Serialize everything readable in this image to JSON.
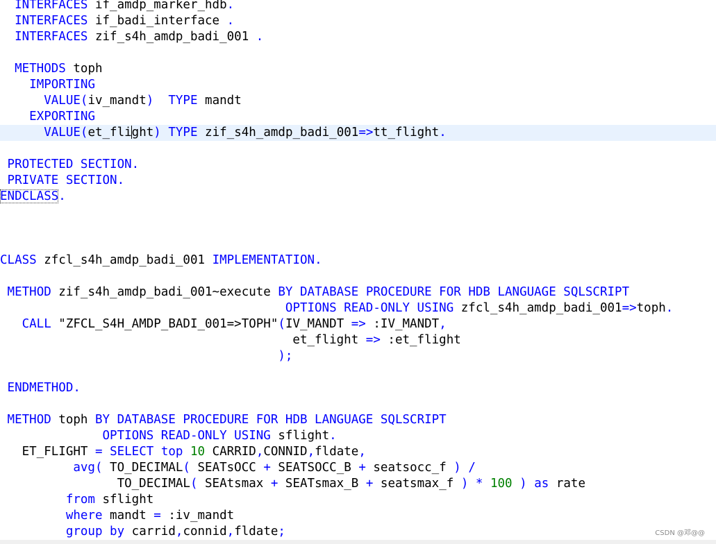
{
  "editor": {
    "lines": [
      [
        {
          "t": "  "
        },
        {
          "t": "INTERFACES",
          "k": "kw"
        },
        {
          "t": " if_amdp_marker_hdb"
        },
        {
          "t": ".",
          "k": "kw"
        }
      ],
      [
        {
          "t": "  "
        },
        {
          "t": "INTERFACES",
          "k": "kw"
        },
        {
          "t": " if_badi_interface "
        },
        {
          "t": ".",
          "k": "kw"
        }
      ],
      [
        {
          "t": "  "
        },
        {
          "t": "INTERFACES",
          "k": "kw"
        },
        {
          "t": " zif_s4h_amdp_badi_001 "
        },
        {
          "t": ".",
          "k": "kw"
        }
      ],
      [],
      [
        {
          "t": "  "
        },
        {
          "t": "METHODS",
          "k": "kw"
        },
        {
          "t": " toph"
        }
      ],
      [
        {
          "t": "    "
        },
        {
          "t": "IMPORTING",
          "k": "kw"
        }
      ],
      [
        {
          "t": "      "
        },
        {
          "t": "VALUE(",
          "k": "kw"
        },
        {
          "t": "iv_mandt"
        },
        {
          "t": ")",
          "k": "kw"
        },
        {
          "t": "  "
        },
        {
          "t": "TYPE",
          "k": "kw"
        },
        {
          "t": " mandt"
        }
      ],
      [
        {
          "t": "    "
        },
        {
          "t": "EXPORTING",
          "k": "kw"
        }
      ],
      [
        {
          "t": "      "
        },
        {
          "t": "VALUE(",
          "k": "kw"
        },
        {
          "t": "et_fli"
        },
        {
          "caret": true
        },
        {
          "t": "ght"
        },
        {
          "t": ")",
          "k": "kw"
        },
        {
          "t": " "
        },
        {
          "t": "TYPE",
          "k": "kw"
        },
        {
          "t": " zif_s4h_amdp_badi_001"
        },
        {
          "t": "=>",
          "k": "kw"
        },
        {
          "t": "tt_flight"
        },
        {
          "t": ".",
          "k": "kw"
        }
      ],
      [],
      [
        {
          "t": " "
        },
        {
          "t": "PROTECTED SECTION.",
          "k": "kw"
        }
      ],
      [
        {
          "t": " "
        },
        {
          "t": "PRIVATE SECTION.",
          "k": "kw"
        }
      ],
      [
        {
          "t": "ENDCLASS",
          "k": "kw",
          "box": true
        },
        {
          "t": ".",
          "k": "kw"
        }
      ],
      [],
      [],
      [],
      [
        {
          "t": "CLASS",
          "k": "kw"
        },
        {
          "t": " zfcl_s4h_amdp_badi_001 "
        },
        {
          "t": "IMPLEMENTATION.",
          "k": "kw"
        }
      ],
      [],
      [
        {
          "t": " "
        },
        {
          "t": "METHOD",
          "k": "kw"
        },
        {
          "t": " zif_s4h_amdp_badi_001~execute "
        },
        {
          "t": "BY DATABASE PROCEDURE FOR HDB LANGUAGE SQLSCRIPT",
          "k": "kw"
        }
      ],
      [
        {
          "t": "                                       "
        },
        {
          "t": "OPTIONS READ-ONLY USING",
          "k": "kw"
        },
        {
          "t": " zfcl_s4h_amdp_badi_001"
        },
        {
          "t": "=>",
          "k": "kw"
        },
        {
          "t": "toph"
        },
        {
          "t": ".",
          "k": "kw"
        }
      ],
      [
        {
          "t": "   "
        },
        {
          "t": "CALL",
          "k": "kw"
        },
        {
          "t": " \"ZFCL_S4H_AMDP_BADI_001=>TOPH\""
        },
        {
          "t": "(",
          "k": "kw"
        },
        {
          "t": "IV_MANDT "
        },
        {
          "t": "=>",
          "k": "kw"
        },
        {
          "t": " :IV_MANDT"
        },
        {
          "t": ",",
          "k": "kw"
        }
      ],
      [
        {
          "t": "                                        et_flight "
        },
        {
          "t": "=>",
          "k": "kw"
        },
        {
          "t": " :et_flight"
        }
      ],
      [
        {
          "t": "                                      "
        },
        {
          "t": ");",
          "k": "kw"
        }
      ],
      [],
      [
        {
          "t": " "
        },
        {
          "t": "ENDMETHOD.",
          "k": "kw"
        }
      ],
      [],
      [
        {
          "t": " "
        },
        {
          "t": "METHOD",
          "k": "kw"
        },
        {
          "t": " toph "
        },
        {
          "t": "BY DATABASE PROCEDURE FOR HDB LANGUAGE SQLSCRIPT",
          "k": "kw"
        }
      ],
      [
        {
          "t": "              "
        },
        {
          "t": "OPTIONS READ-ONLY USING",
          "k": "kw"
        },
        {
          "t": " sflight"
        },
        {
          "t": ".",
          "k": "kw"
        }
      ],
      [
        {
          "t": "   ET_FLIGHT "
        },
        {
          "t": "=",
          "k": "kw"
        },
        {
          "t": " "
        },
        {
          "t": "SELECT top",
          "k": "kw"
        },
        {
          "t": " "
        },
        {
          "t": "10",
          "k": "num"
        },
        {
          "t": " CARRID"
        },
        {
          "t": ",",
          "k": "kw"
        },
        {
          "t": "CONNID"
        },
        {
          "t": ",",
          "k": "kw"
        },
        {
          "t": "fldate"
        },
        {
          "t": ",",
          "k": "kw"
        }
      ],
      [
        {
          "t": "          "
        },
        {
          "t": "avg(",
          "k": "kw"
        },
        {
          "t": " TO_DECIMAL"
        },
        {
          "t": "(",
          "k": "kw"
        },
        {
          "t": " SEATsOCC "
        },
        {
          "t": "+",
          "k": "kw"
        },
        {
          "t": " SEATSOCC_B "
        },
        {
          "t": "+",
          "k": "kw"
        },
        {
          "t": " seatsocc_f "
        },
        {
          "t": ") /",
          "k": "kw"
        }
      ],
      [
        {
          "t": "                TO_DECIMAL"
        },
        {
          "t": "(",
          "k": "kw"
        },
        {
          "t": " SEAtsmax "
        },
        {
          "t": "+",
          "k": "kw"
        },
        {
          "t": " SEATsmax_B "
        },
        {
          "t": "+",
          "k": "kw"
        },
        {
          "t": " seatsmax_f "
        },
        {
          "t": ") *",
          "k": "kw"
        },
        {
          "t": " "
        },
        {
          "t": "100",
          "k": "num"
        },
        {
          "t": " "
        },
        {
          "t": ")",
          "k": "kw"
        },
        {
          "t": " "
        },
        {
          "t": "as",
          "k": "kw"
        },
        {
          "t": " rate"
        }
      ],
      [
        {
          "t": "         "
        },
        {
          "t": "from",
          "k": "kw"
        },
        {
          "t": " sflight"
        }
      ],
      [
        {
          "t": "         "
        },
        {
          "t": "where",
          "k": "kw"
        },
        {
          "t": " mandt "
        },
        {
          "t": "=",
          "k": "kw"
        },
        {
          "t": " :iv_mandt"
        }
      ],
      [
        {
          "t": "         "
        },
        {
          "t": "group by",
          "k": "kw"
        },
        {
          "t": " carrid"
        },
        {
          "t": ",",
          "k": "kw"
        },
        {
          "t": "connid"
        },
        {
          "t": ",",
          "k": "kw"
        },
        {
          "t": "fldate"
        },
        {
          "t": ";",
          "k": "kw"
        }
      ]
    ]
  },
  "watermark": "CSDN @邓@@"
}
